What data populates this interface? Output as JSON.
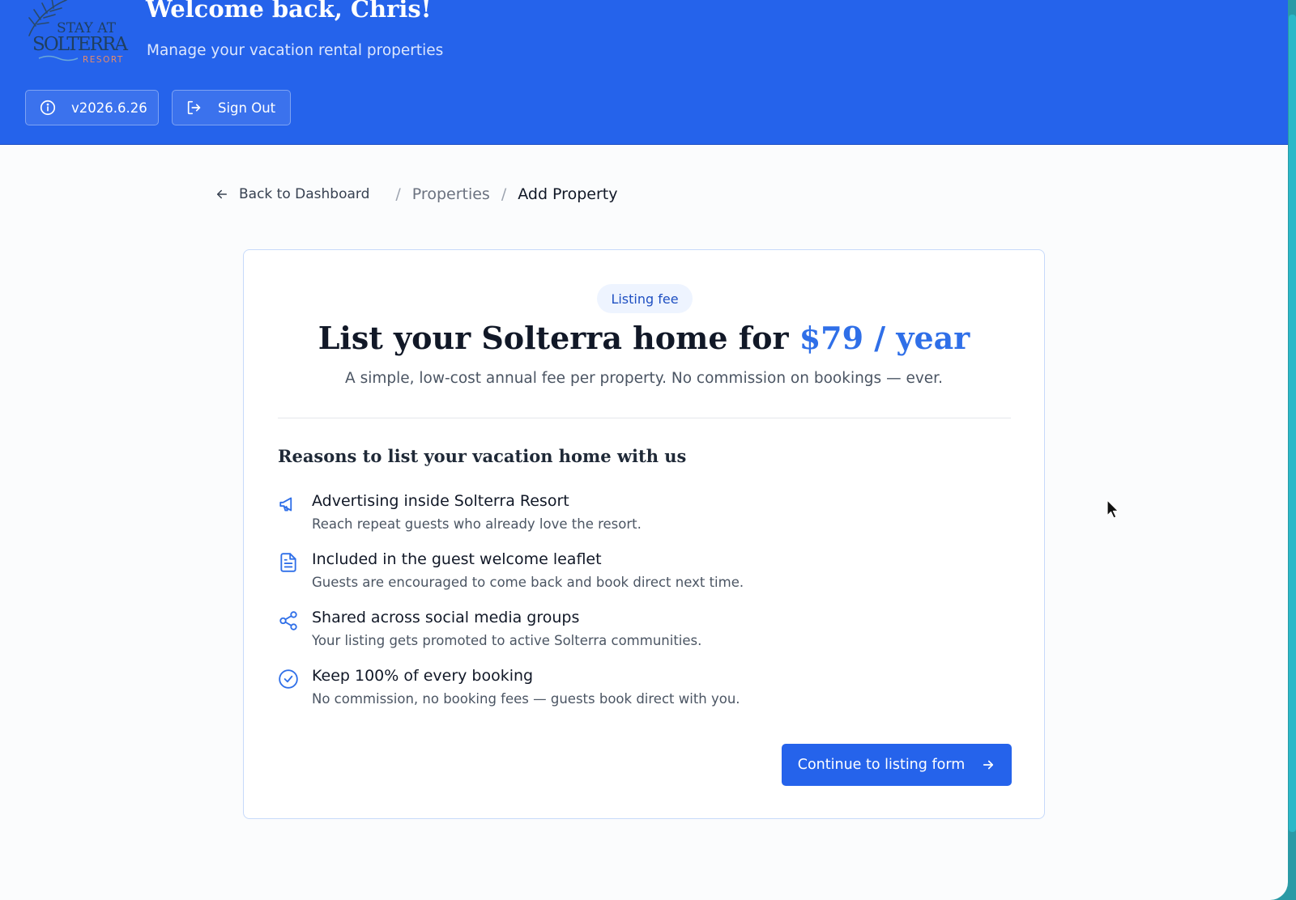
{
  "header": {
    "logo": {
      "line1": "STAY AT",
      "line2": "SOLTERRA",
      "line3": "RESORT"
    },
    "welcome": "Welcome back, Chris!",
    "subtitle": "Manage your vacation rental properties",
    "version_label": "v2026.6.26",
    "signout_label": "Sign Out"
  },
  "breadcrumb": {
    "back_label": "Back to Dashboard",
    "separator": "/",
    "properties_label": "Properties",
    "current_label": "Add Property"
  },
  "card": {
    "badge": "Listing fee",
    "headline_prefix": "List your Solterra home for",
    "headline_price": "$79 / year",
    "tagline": "A simple, low-cost annual fee per property. No commission on bookings — ever.",
    "reasons_title": "Reasons to list your vacation home with us",
    "benefits": [
      {
        "icon": "megaphone-icon",
        "title": "Advertising inside Solterra Resort",
        "desc": "Reach repeat guests who already love the resort."
      },
      {
        "icon": "document-icon",
        "title": "Included in the guest welcome leaflet",
        "desc": "Guests are encouraged to come back and book direct next time."
      },
      {
        "icon": "share-icon",
        "title": "Shared across social media groups",
        "desc": "Your listing gets promoted to active Solterra communities."
      },
      {
        "icon": "check-circle-icon",
        "title": "Keep 100% of every booking",
        "desc": "No commission, no booking fees — guests book direct with you."
      }
    ],
    "cta_label": "Continue to listing form"
  },
  "colors": {
    "header_bg": "#2563eb",
    "accent": "#2f6fe8",
    "badge_bg": "#eef4ff",
    "scrollbar": "#2bb8c8"
  }
}
